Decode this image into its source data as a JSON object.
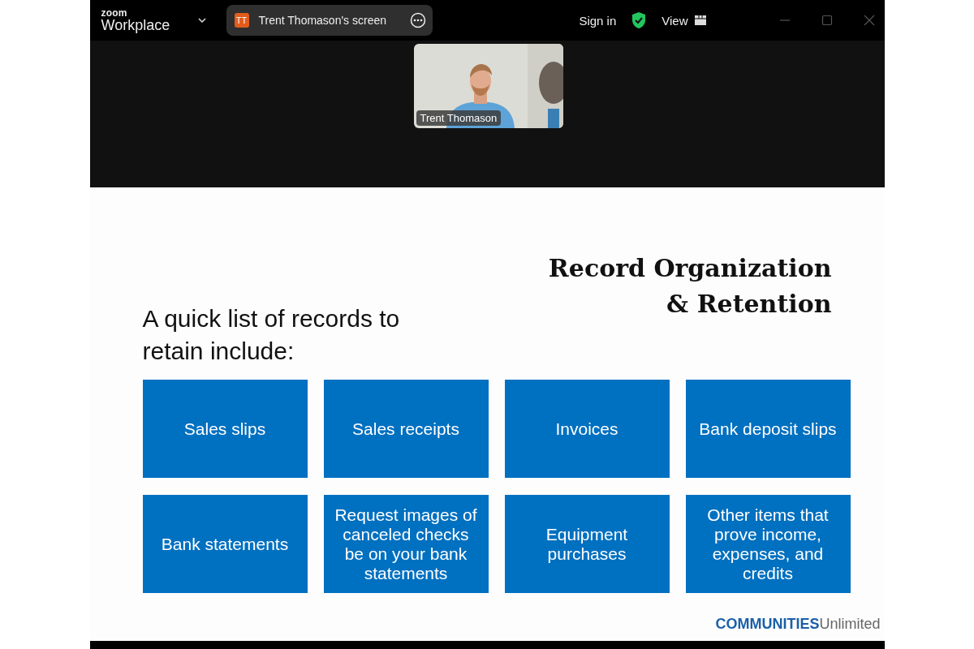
{
  "app_bar": {
    "logo_top": "zoom",
    "logo_name": "Workplace",
    "share_badge": {
      "initials": "TT",
      "label": "Trent Thomason's screen"
    },
    "sign_in": "Sign in",
    "view": "View"
  },
  "participant": {
    "kind": "picture",
    "name": "Trent Thomason"
  },
  "slide": {
    "title_lines": [
      "Record Organization",
      "& Retention"
    ],
    "intro": "A quick list of records to retain include:",
    "tiles": [
      "Sales slips",
      "Sales receipts",
      "Invoices",
      "Bank deposit slips",
      "Bank statements",
      "Request images of canceled checks be on your bank statements",
      "Equipment purchases",
      "Other items that prove income, expenses, and credits"
    ],
    "brand_bold": "COMMUNITIES",
    "brand_light": "Unlimited"
  }
}
